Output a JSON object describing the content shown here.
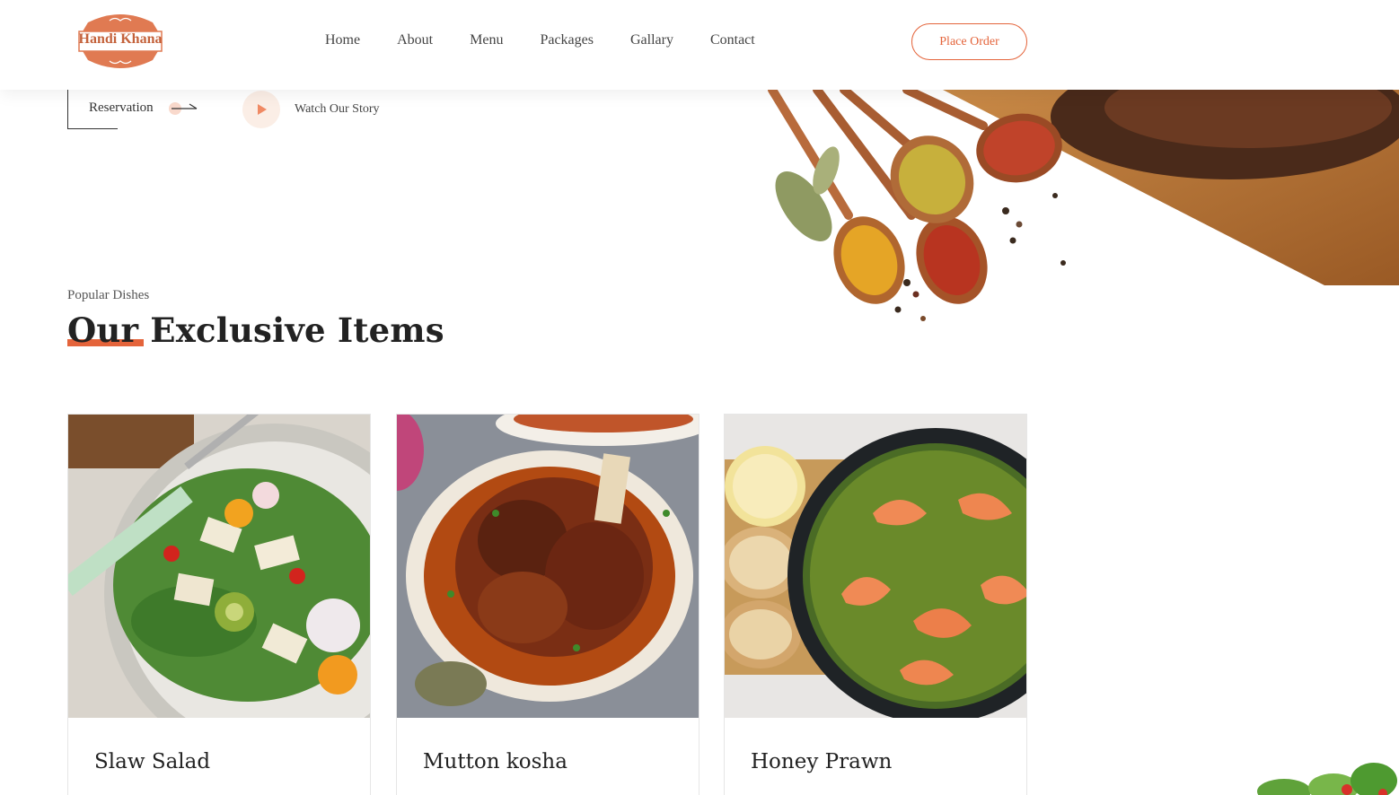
{
  "brand": {
    "name": "Handi Khana",
    "accent": "#e4643b"
  },
  "nav": {
    "items": [
      "Home",
      "About",
      "Menu",
      "Packages",
      "Gallary",
      "Contact"
    ],
    "cta": "Place Order"
  },
  "hero": {
    "reservation": "Reservation",
    "watch_story": "Watch Our Story"
  },
  "section": {
    "eyebrow": "Popular Dishes",
    "title": "Our Exclusive Items"
  },
  "dishes": [
    {
      "name": "Slaw Salad"
    },
    {
      "name": "Mutton kosha"
    },
    {
      "name": "Honey Prawn"
    }
  ]
}
